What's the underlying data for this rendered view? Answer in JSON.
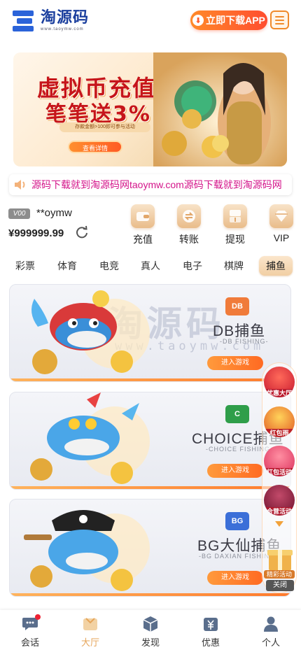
{
  "header": {
    "logo_title": "淘源码",
    "logo_sub": "www.taoymw.com",
    "download_label": "立即下载APP"
  },
  "banner": {
    "title": "虚拟币充值",
    "subtitle": "笔笔送3%",
    "note": "存款金额>100即可参与活动",
    "button": "查看详情"
  },
  "marquee": {
    "text": "源码下载就到淘源码网taoymw.com源码下载就到淘源码网"
  },
  "account": {
    "vip_level": "V00",
    "username": "**oymw",
    "balance": "¥999999.99"
  },
  "quick_actions": [
    {
      "label": "充值",
      "icon": "wallet-icon"
    },
    {
      "label": "转账",
      "icon": "transfer-icon"
    },
    {
      "label": "提现",
      "icon": "withdraw-icon"
    },
    {
      "label": "VIP",
      "icon": "diamond-icon"
    }
  ],
  "categories": [
    "彩票",
    "体育",
    "电竞",
    "真人",
    "电子",
    "棋牌",
    "捕鱼"
  ],
  "active_category": "捕鱼",
  "watermark": {
    "text": "淘源码",
    "sub": "www.taoymw.com"
  },
  "games": [
    {
      "logo": "DB",
      "title": "DB捕鱼",
      "sub": "-DB FISHING-",
      "button": "进入游戏",
      "color": "#f07b3a"
    },
    {
      "logo": "C",
      "title": "CHOICE捕鱼",
      "sub": "-CHOICE FISHING-",
      "button": "进入游戏",
      "color": "#2f9e4a"
    },
    {
      "logo": "BG",
      "title": "BG大仙捕鱼",
      "sub": "-BG DAXIAN FISHING-",
      "button": "进入游戏",
      "color": "#3b6fd8"
    }
  ],
  "side_promos": [
    "优惠大厅",
    "红包雨",
    "红包活动",
    "合营活动"
  ],
  "lottery_label": "精彩活动",
  "close_label": "关闭",
  "bottom_nav": [
    {
      "label": "会话",
      "icon": "chat-icon"
    },
    {
      "label": "大厅",
      "icon": "lobby-icon"
    },
    {
      "label": "发现",
      "icon": "cube-icon"
    },
    {
      "label": "优惠",
      "icon": "yuan-gift-icon"
    },
    {
      "label": "个人",
      "icon": "user-icon"
    }
  ],
  "colors": {
    "accent": "#ff6a22",
    "marquee": "#d4148a",
    "brand": "#1b3f9e",
    "nav_active": "#e6a55a"
  }
}
